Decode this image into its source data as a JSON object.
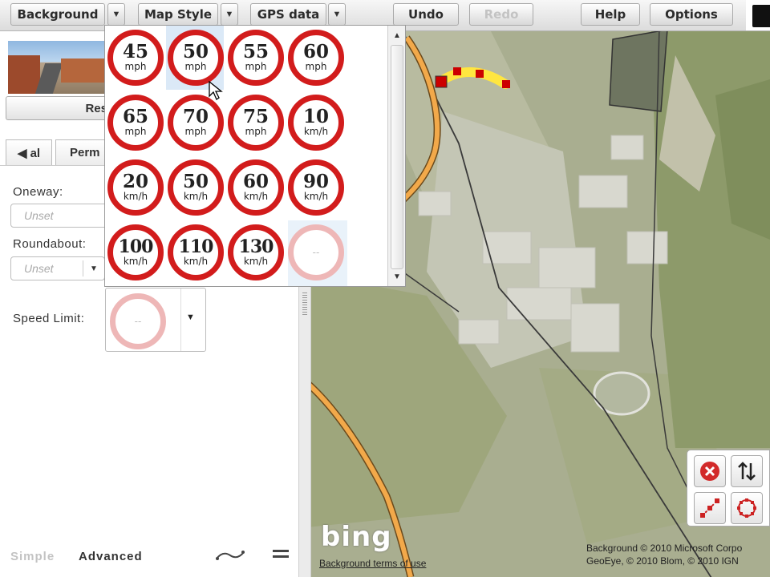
{
  "toolbar": {
    "background_label": "Background",
    "map_style_label": "Map Style",
    "gps_data_label": "GPS data",
    "undo_label": "Undo",
    "redo_label": "Redo",
    "help_label": "Help",
    "options_label": "Options",
    "dropdown_arrow": "▼"
  },
  "panel": {
    "reset_label": "Res",
    "tabs": [
      "◀ al",
      "Perm"
    ],
    "oneway_label": "Oneway:",
    "oneway_value": "Unset",
    "roundabout_label": "Roundabout:",
    "roundabout_value": "Unset",
    "speed_limit_label": "Speed Limit:",
    "speed_limit_value": "--",
    "mode_simple": "Simple",
    "mode_advanced": "Advanced"
  },
  "speed_popup": {
    "signs": [
      {
        "value": "45",
        "unit": "mph"
      },
      {
        "value": "50",
        "unit": "mph"
      },
      {
        "value": "55",
        "unit": "mph"
      },
      {
        "value": "60",
        "unit": "mph"
      },
      {
        "value": "65",
        "unit": "mph"
      },
      {
        "value": "70",
        "unit": "mph"
      },
      {
        "value": "75",
        "unit": "mph"
      },
      {
        "value": "10",
        "unit": "km/h"
      },
      {
        "value": "20",
        "unit": "km/h"
      },
      {
        "value": "50",
        "unit": "km/h"
      },
      {
        "value": "60",
        "unit": "km/h"
      },
      {
        "value": "90",
        "unit": "km/h"
      },
      {
        "value": "100",
        "unit": "km/h"
      },
      {
        "value": "110",
        "unit": "km/h"
      },
      {
        "value": "130",
        "unit": "km/h"
      },
      {
        "value": "--",
        "unit": ""
      }
    ],
    "highlighted_value": "50 mph",
    "unset_value": "--"
  },
  "map": {
    "bing_logo": "bing",
    "terms_link": "Background terms of use",
    "copyright_line1": "Background © 2010 Microsoft Corpo",
    "copyright_line2": "GeoEye, © 2010 Blom, © 2010 IGN"
  },
  "map_tools": {
    "icons": [
      "delete-icon",
      "reverse-direction-icon",
      "straighten-icon",
      "circularize-icon"
    ]
  },
  "colors": {
    "sign_red": "#d21c1c",
    "road": "#f2a94a",
    "selected_segment": "#ffe640",
    "node": "#cc0000",
    "selection_highlight": "#dbe9f7"
  }
}
